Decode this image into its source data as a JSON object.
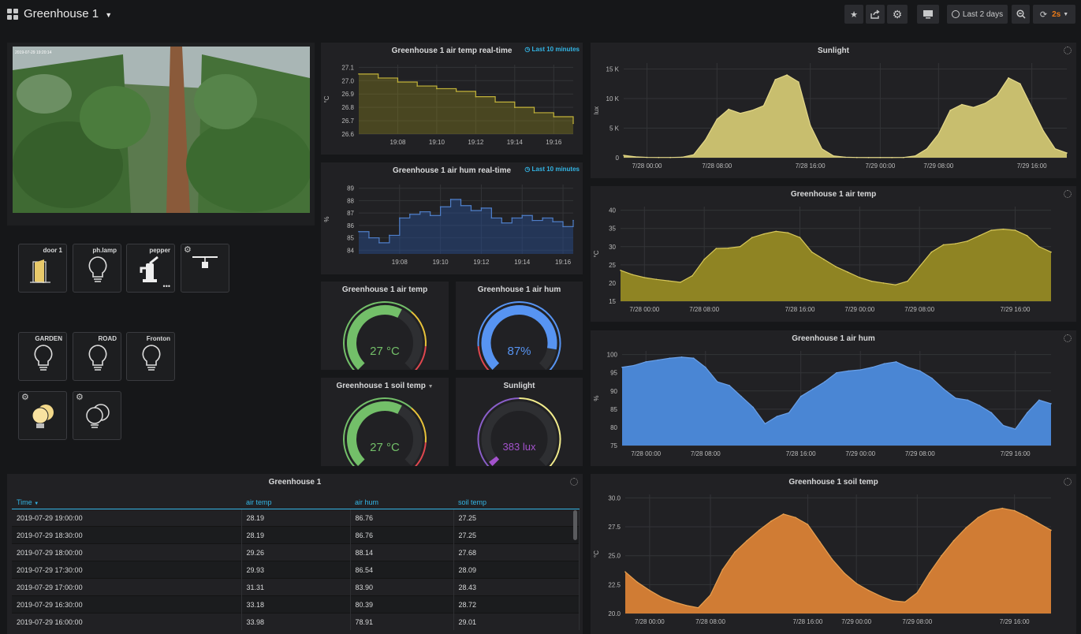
{
  "dashboard": {
    "title": "Greenhouse 1"
  },
  "toolbar": {
    "time_range": "Last 2 days",
    "refresh": "2s"
  },
  "camera": {
    "timestamp": "2019-07-29 19:20:14"
  },
  "devices": [
    {
      "label": "door 1"
    },
    {
      "label": "ph.lamp"
    },
    {
      "label": "pepper"
    },
    {
      "label": ""
    },
    {
      "label": "GARDEN"
    },
    {
      "label": "ROAD"
    },
    {
      "label": "Fronton"
    }
  ],
  "realtime": {
    "temp": {
      "title": "Greenhouse 1 air temp real-time",
      "note": "Last 10 minutes",
      "unit": "°C"
    },
    "hum": {
      "title": "Greenhouse 1 air hum real-time",
      "note": "Last 10 minutes",
      "unit": "%"
    }
  },
  "gauges": {
    "air_temp": {
      "title": "Greenhouse 1 air temp",
      "value": "27 °C",
      "level": 0.6
    },
    "air_hum": {
      "title": "Greenhouse 1 air hum",
      "value": "87%",
      "level": 0.87
    },
    "soil_temp": {
      "title": "Greenhouse 1 soil temp",
      "value": "27 °C",
      "level": 0.6
    },
    "sunlight": {
      "title": "Sunlight",
      "value": "383 lux",
      "level": 0.03
    }
  },
  "colors": {
    "yellow": "#c8be6e",
    "blue": "#4a86d4",
    "orange": "#d07c34",
    "green": "#73bf69",
    "purple": "#a352cc",
    "accent": "#33b5e5"
  },
  "table": {
    "title": "Greenhouse 1",
    "columns": [
      "Time",
      "air temp",
      "air hum",
      "soil temp"
    ],
    "rows": [
      [
        "2019-07-29 19:00:00",
        "28.19",
        "86.76",
        "27.25"
      ],
      [
        "2019-07-29 18:30:00",
        "28.19",
        "86.76",
        "27.25"
      ],
      [
        "2019-07-29 18:00:00",
        "29.26",
        "88.14",
        "27.68"
      ],
      [
        "2019-07-29 17:30:00",
        "29.93",
        "86.54",
        "28.09"
      ],
      [
        "2019-07-29 17:00:00",
        "31.31",
        "83.90",
        "28.43"
      ],
      [
        "2019-07-29 16:30:00",
        "33.18",
        "80.39",
        "28.72"
      ],
      [
        "2019-07-29 16:00:00",
        "33.98",
        "78.91",
        "29.01"
      ]
    ]
  },
  "chart_data": [
    {
      "id": "rt_temp",
      "type": "line",
      "title": "Greenhouse 1 air temp real-time",
      "ylabel": "°C",
      "x": [
        "19:06",
        "19:07",
        "19:08",
        "19:09",
        "19:10",
        "19:11",
        "19:12",
        "19:13",
        "19:14",
        "19:15",
        "19:16",
        "19:16:30"
      ],
      "x_ticks": [
        "19:08",
        "19:10",
        "19:12",
        "19:14",
        "19:16"
      ],
      "y_ticks": [
        "26.6",
        "26.7",
        "26.8",
        "26.9",
        "27.0",
        "27.1"
      ],
      "ylim": [
        26.6,
        27.12
      ],
      "values": [
        27.05,
        27.02,
        26.99,
        26.96,
        26.94,
        26.92,
        26.88,
        26.84,
        26.8,
        26.76,
        26.73,
        26.68
      ]
    },
    {
      "id": "rt_hum",
      "type": "line",
      "title": "Greenhouse 1 air hum real-time",
      "ylabel": "%",
      "x": [
        "19:06",
        "19:06:30",
        "19:07",
        "19:07:30",
        "19:08",
        "19:08:30",
        "19:09",
        "19:09:30",
        "19:10",
        "19:10:30",
        "19:11",
        "19:11:30",
        "19:12",
        "19:12:30",
        "19:13",
        "19:13:30",
        "19:14",
        "19:14:30",
        "19:15",
        "19:15:30",
        "19:16",
        "19:16:30"
      ],
      "x_ticks": [
        "19:08",
        "19:10",
        "19:12",
        "19:14",
        "19:16"
      ],
      "y_ticks": [
        "84",
        "85",
        "86",
        "87",
        "88",
        "89"
      ],
      "ylim": [
        83.7,
        89.3
      ],
      "values": [
        85.5,
        85.0,
        84.6,
        85.2,
        86.6,
        86.9,
        87.1,
        86.8,
        87.5,
        88.1,
        87.6,
        87.2,
        87.4,
        86.6,
        86.2,
        86.6,
        86.8,
        86.4,
        86.6,
        86.3,
        85.9,
        86.4
      ]
    },
    {
      "id": "sunlight",
      "type": "area",
      "title": "Sunlight",
      "ylabel": "lux",
      "x": [
        "7/27 20:00",
        "7/27 22:00",
        "7/28 00:00",
        "7/28 02:00",
        "7/28 04:00",
        "7/28 05:00",
        "7/28 06:00",
        "7/28 07:00",
        "7/28 08:00",
        "7/28 09:00",
        "7/28 10:00",
        "7/28 11:00",
        "7/28 12:00",
        "7/28 13:00",
        "7/28 14:00",
        "7/28 15:00",
        "7/28 16:00",
        "7/28 17:00",
        "7/28 18:00",
        "7/28 19:00",
        "7/28 20:00",
        "7/28 22:00",
        "7/29 00:00",
        "7/29 02:00",
        "7/29 04:00",
        "7/29 06:00",
        "7/29 07:00",
        "7/29 08:00",
        "7/29 09:00",
        "7/29 10:00",
        "7/29 11:00",
        "7/29 12:00",
        "7/29 13:00",
        "7/29 14:00",
        "7/29 15:00",
        "7/29 16:00",
        "7/29 17:00",
        "7/29 18:00",
        "7/29 19:00"
      ],
      "x_ticks": [
        "7/28 00:00",
        "7/28 08:00",
        "7/28 16:00",
        "7/29 00:00",
        "7/29 08:00",
        "7/29 16:00"
      ],
      "y_ticks": [
        "0",
        "5 K",
        "10 K",
        "15 K"
      ],
      "ylim": [
        0,
        16000
      ],
      "values": [
        400,
        150,
        60,
        40,
        40,
        80,
        500,
        3000,
        6500,
        8200,
        7500,
        8000,
        8800,
        13200,
        14000,
        12800,
        5500,
        1500,
        300,
        80,
        40,
        30,
        30,
        30,
        40,
        300,
        1500,
        4000,
        8000,
        9000,
        8500,
        9200,
        10500,
        13500,
        12500,
        8500,
        4500,
        1500,
        800
      ]
    },
    {
      "id": "air_temp",
      "type": "area",
      "title": "Greenhouse 1 air temp",
      "ylabel": "°C",
      "x": [
        "7/27 20:00",
        "7/27 22:00",
        "7/28 00:00",
        "7/28 02:00",
        "7/28 04:00",
        "7/28 06:00",
        "7/28 07:00",
        "7/28 08:00",
        "7/28 09:00",
        "7/28 10:00",
        "7/28 11:00",
        "7/28 12:00",
        "7/28 13:00",
        "7/28 14:00",
        "7/28 15:00",
        "7/28 16:00",
        "7/28 17:00",
        "7/28 18:00",
        "7/28 20:00",
        "7/28 22:00",
        "7/29 00:00",
        "7/29 02:00",
        "7/29 04:00",
        "7/29 06:00",
        "7/29 07:00",
        "7/29 08:00",
        "7/29 09:00",
        "7/29 10:00",
        "7/29 11:00",
        "7/29 12:00",
        "7/29 13:00",
        "7/29 14:00",
        "7/29 15:00",
        "7/29 16:00",
        "7/29 17:00",
        "7/29 18:00",
        "7/29 19:00"
      ],
      "x_ticks": [
        "7/28 00:00",
        "7/28 08:00",
        "7/28 16:00",
        "7/29 00:00",
        "7/29 08:00",
        "7/29 16:00"
      ],
      "y_ticks": [
        "15",
        "20",
        "25",
        "30",
        "35",
        "40"
      ],
      "ylim": [
        15,
        41
      ],
      "values": [
        23.5,
        22.3,
        21.5,
        21.0,
        20.6,
        20.2,
        22.0,
        26.5,
        29.5,
        29.6,
        30.0,
        32.5,
        33.5,
        34.2,
        33.8,
        32.5,
        28.5,
        26.5,
        24.5,
        23.0,
        21.5,
        20.5,
        20.0,
        19.5,
        20.5,
        24.5,
        28.5,
        30.5,
        30.8,
        31.5,
        33.0,
        34.5,
        34.8,
        34.5,
        33.0,
        30.0,
        28.5
      ]
    },
    {
      "id": "air_hum",
      "type": "area",
      "title": "Greenhouse 1 air hum",
      "ylabel": "%",
      "x": [
        "7/27 20:00",
        "7/27 22:00",
        "7/28 00:00",
        "7/28 02:00",
        "7/28 04:00",
        "7/28 06:00",
        "7/28 07:00",
        "7/28 08:00",
        "7/28 09:00",
        "7/28 10:00",
        "7/28 11:00",
        "7/28 12:00",
        "7/28 13:00",
        "7/28 14:00",
        "7/28 15:00",
        "7/28 16:00",
        "7/28 17:00",
        "7/28 18:00",
        "7/28 20:00",
        "7/28 22:00",
        "7/29 00:00",
        "7/29 02:00",
        "7/29 04:00",
        "7/29 06:00",
        "7/29 07:00",
        "7/29 08:00",
        "7/29 09:00",
        "7/29 10:00",
        "7/29 11:00",
        "7/29 12:00",
        "7/29 13:00",
        "7/29 14:00",
        "7/29 15:00",
        "7/29 16:00",
        "7/29 17:00",
        "7/29 18:00",
        "7/29 19:00"
      ],
      "x_ticks": [
        "7/28 00:00",
        "7/28 08:00",
        "7/28 16:00",
        "7/29 00:00",
        "7/29 08:00",
        "7/29 16:00"
      ],
      "y_ticks": [
        "75",
        "80",
        "85",
        "90",
        "95",
        "100"
      ],
      "ylim": [
        75,
        101
      ],
      "values": [
        96.5,
        97.0,
        98.0,
        98.5,
        99.0,
        99.3,
        99.0,
        96.5,
        92.5,
        91.5,
        88.5,
        85.5,
        81.0,
        83.0,
        84.0,
        88.5,
        90.5,
        92.5,
        95.0,
        95.5,
        95.8,
        96.5,
        97.5,
        98.0,
        96.5,
        95.5,
        93.5,
        90.5,
        88.0,
        87.5,
        86.0,
        84.0,
        80.5,
        79.5,
        84.0,
        87.5,
        86.5
      ]
    },
    {
      "id": "soil_temp",
      "type": "area",
      "title": "Greenhouse 1 soil temp",
      "ylabel": "°C",
      "x": [
        "7/27 20:00",
        "7/27 22:00",
        "7/28 00:00",
        "7/28 02:00",
        "7/28 04:00",
        "7/28 06:00",
        "7/28 07:00",
        "7/28 08:00",
        "7/28 09:00",
        "7/28 10:00",
        "7/28 11:00",
        "7/28 12:00",
        "7/28 13:00",
        "7/28 14:00",
        "7/28 15:00",
        "7/28 16:00",
        "7/28 18:00",
        "7/28 20:00",
        "7/28 22:00",
        "7/29 00:00",
        "7/29 02:00",
        "7/29 04:00",
        "7/29 06:00",
        "7/29 07:00",
        "7/29 08:00",
        "7/29 09:00",
        "7/29 10:00",
        "7/29 11:00",
        "7/29 12:00",
        "7/29 13:00",
        "7/29 14:00",
        "7/29 15:00",
        "7/29 16:00",
        "7/29 17:00",
        "7/29 18:00",
        "7/29 19:00"
      ],
      "x_ticks": [
        "7/28 00:00",
        "7/28 08:00",
        "7/28 16:00",
        "7/29 00:00",
        "7/29 08:00",
        "7/29 16:00"
      ],
      "y_ticks": [
        "20.0",
        "22.5",
        "25.0",
        "27.5",
        "30.0"
      ],
      "ylim": [
        20,
        30.3
      ],
      "values": [
        23.6,
        22.7,
        22.0,
        21.4,
        21.0,
        20.7,
        20.5,
        21.6,
        23.8,
        25.3,
        26.3,
        27.2,
        28.0,
        28.6,
        28.3,
        27.7,
        26.2,
        24.7,
        23.5,
        22.6,
        22.0,
        21.5,
        21.1,
        21.0,
        21.8,
        23.5,
        25.0,
        26.3,
        27.4,
        28.3,
        28.9,
        29.1,
        28.9,
        28.4,
        27.8,
        27.2
      ]
    }
  ]
}
